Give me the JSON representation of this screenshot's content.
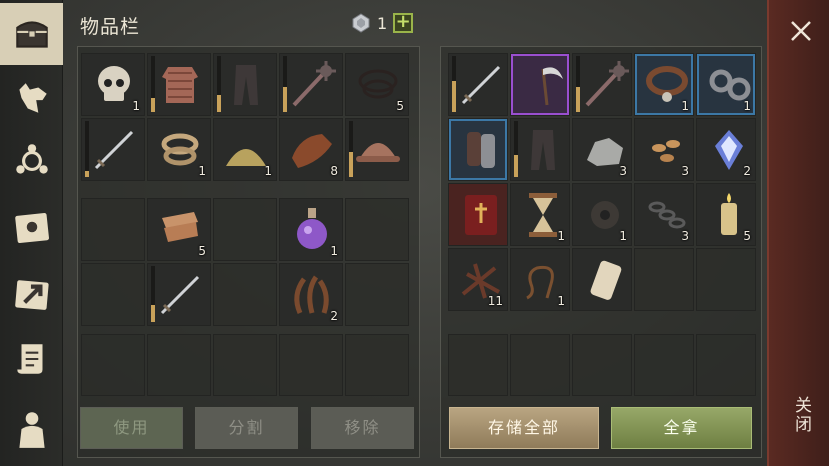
{
  "header": {
    "title": "物品栏",
    "currency_value": "1",
    "add_label": "+"
  },
  "sidebar": {
    "items": [
      {
        "name": "chest-icon",
        "active": true
      },
      {
        "name": "dog-icon",
        "active": false
      },
      {
        "name": "crafting-icon",
        "active": false
      },
      {
        "name": "sun-map-icon",
        "active": false
      },
      {
        "name": "arrow-map-icon",
        "active": false
      },
      {
        "name": "scroll-icon",
        "active": false
      },
      {
        "name": "character-icon",
        "active": false
      }
    ]
  },
  "inventory": {
    "row1": [
      {
        "name": "skull",
        "qty": "1"
      },
      {
        "name": "chainmail",
        "qty": "",
        "durability": 0.25
      },
      {
        "name": "pants",
        "qty": "",
        "durability": 0.3
      },
      {
        "name": "mace",
        "qty": "",
        "durability": 0.45
      },
      {
        "name": "rope-coil",
        "qty": "5"
      }
    ],
    "row2": [
      {
        "name": "sword",
        "qty": "",
        "durability": 0.1
      },
      {
        "name": "rope",
        "qty": "1"
      },
      {
        "name": "sand-pile",
        "qty": "1"
      },
      {
        "name": "leather",
        "qty": "8"
      },
      {
        "name": "helmet",
        "qty": "",
        "durability": 0.45
      }
    ],
    "row3": [
      {
        "name": "",
        "qty": ""
      },
      {
        "name": "cloth",
        "qty": "5"
      },
      {
        "name": "",
        "qty": ""
      },
      {
        "name": "potion",
        "qty": "1"
      },
      {
        "name": "",
        "qty": ""
      }
    ],
    "row4": [
      {
        "name": "",
        "qty": ""
      },
      {
        "name": "sword",
        "qty": "",
        "durability": 0.3
      },
      {
        "name": "",
        "qty": ""
      },
      {
        "name": "roots",
        "qty": "2"
      },
      {
        "name": "",
        "qty": ""
      }
    ]
  },
  "storage": {
    "row1": [
      {
        "name": "sword",
        "qty": "",
        "durability": 0.55
      },
      {
        "name": "scythe",
        "qty": "",
        "rarity": "purple"
      },
      {
        "name": "mace",
        "qty": "",
        "durability": 0.45
      },
      {
        "name": "collar",
        "qty": "1",
        "rarity": "blue"
      },
      {
        "name": "shackles",
        "qty": "1",
        "rarity": "blue"
      }
    ],
    "row2": [
      {
        "name": "gauntlets",
        "qty": "",
        "rarity": "blue"
      },
      {
        "name": "pants",
        "qty": "",
        "durability": 0.4
      },
      {
        "name": "ore",
        "qty": "3"
      },
      {
        "name": "seeds",
        "qty": "3"
      },
      {
        "name": "crystal",
        "qty": "2"
      }
    ],
    "row3": [
      {
        "name": "book",
        "qty": "",
        "rarity": "red"
      },
      {
        "name": "hourglass",
        "qty": "1"
      },
      {
        "name": "gear",
        "qty": "1"
      },
      {
        "name": "chain",
        "qty": "3"
      },
      {
        "name": "candle",
        "qty": "5"
      }
    ],
    "row4": [
      {
        "name": "twigs",
        "qty": "11"
      },
      {
        "name": "whip",
        "qty": "1"
      },
      {
        "name": "scroll",
        "qty": ""
      },
      {
        "name": "",
        "qty": ""
      },
      {
        "name": "",
        "qty": ""
      }
    ]
  },
  "actions": {
    "use_label": "使用",
    "split_label": "分割",
    "remove_label": "移除",
    "store_all_label": "存储全部",
    "take_all_label": "全拿"
  },
  "close": {
    "label": "关闭"
  },
  "colors": {
    "accent_green": "#9ab44a",
    "rarity_purple": "#9a4fd0",
    "rarity_blue": "#3c78a6",
    "close_red": "#5a2a22"
  }
}
